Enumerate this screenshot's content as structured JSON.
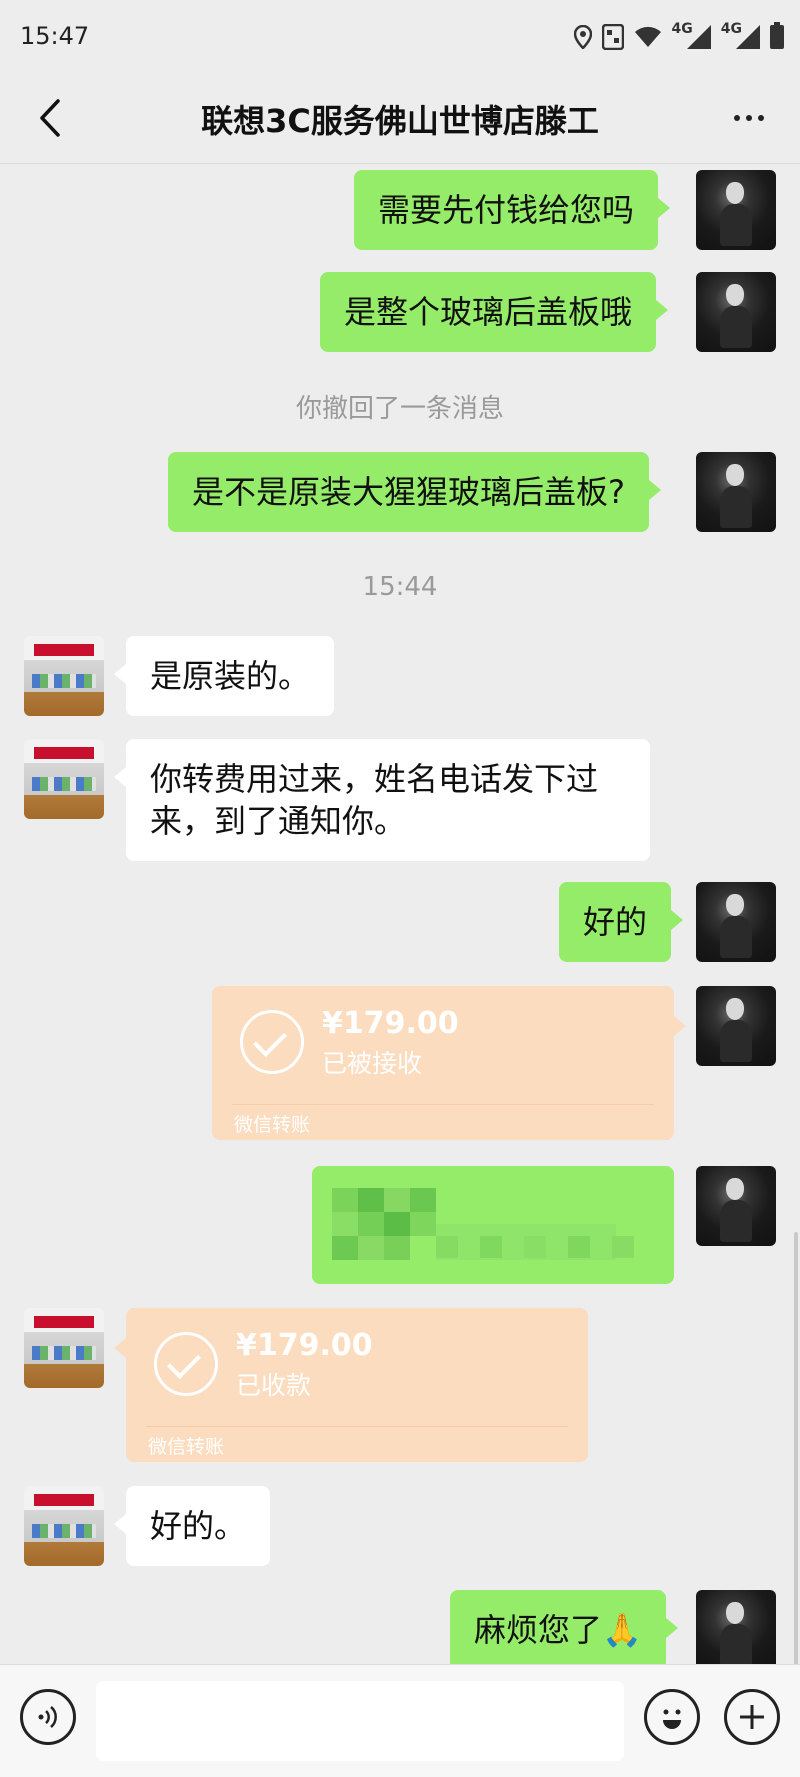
{
  "status_bar": {
    "time": "15:47",
    "icons": [
      "location-icon",
      "nfc-icon",
      "wifi-icon",
      "signal-4g-icon",
      "signal-4g-icon",
      "battery-icon"
    ],
    "network_label_1": "4G",
    "network_label_2": "4G"
  },
  "header": {
    "title": "联想3C服务佛山世博店滕工",
    "back_icon": "chevron-left-icon",
    "more_icon": "more-dots-icon"
  },
  "messages": [
    {
      "sender": "me",
      "type": "text",
      "text": "需要先付钱给您吗"
    },
    {
      "sender": "me",
      "type": "text",
      "text": "是整个玻璃后盖板哦"
    },
    {
      "sender": "system",
      "type": "recall",
      "text": "你撤回了一条消息"
    },
    {
      "sender": "me",
      "type": "text",
      "text": "是不是原装大猩猩玻璃后盖板?"
    },
    {
      "sender": "system",
      "type": "time",
      "text": "15:44"
    },
    {
      "sender": "them",
      "type": "text",
      "text": "是原装的。"
    },
    {
      "sender": "them",
      "type": "text",
      "lines": [
        "你转费用过来，姓名电话发下过",
        "来，到了通知你。"
      ]
    },
    {
      "sender": "me",
      "type": "text",
      "text": "好的"
    },
    {
      "sender": "me",
      "type": "transfer",
      "amount": "¥179.00",
      "status": "已被接收",
      "label": "微信转账"
    },
    {
      "sender": "me",
      "type": "redacted",
      "text": ""
    },
    {
      "sender": "them",
      "type": "transfer",
      "amount": "¥179.00",
      "status": "已收款",
      "label": "微信转账"
    },
    {
      "sender": "them",
      "type": "text",
      "text": "好的。"
    },
    {
      "sender": "me",
      "type": "text",
      "text": "麻烦您了🙏"
    }
  ],
  "input_bar": {
    "voice_icon": "voice-icon",
    "emoji_icon": "emoji-icon",
    "plus_icon": "plus-icon"
  },
  "colors": {
    "background": "#ededed",
    "my_bubble": "#95ec69",
    "their_bubble": "#ffffff",
    "transfer_card": "#fbdcbf"
  }
}
